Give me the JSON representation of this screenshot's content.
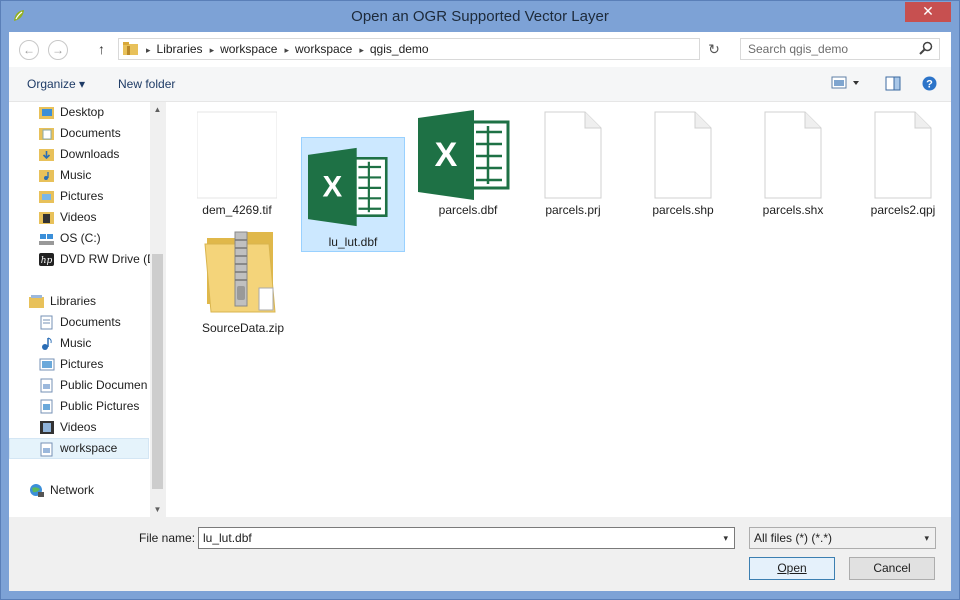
{
  "window": {
    "title": "Open an OGR Supported Vector Layer",
    "close_glyph": "✕"
  },
  "navbar": {
    "back_glyph": "←",
    "forward_glyph": "→",
    "up_glyph": "↑",
    "breadcrumbs": [
      "Libraries",
      "workspace",
      "workspace",
      "qgis_demo"
    ],
    "separator": "▸",
    "dropdown_glyph": "▾",
    "refresh_glyph": "↻",
    "search_placeholder": "Search qgis_demo"
  },
  "toolbar": {
    "organize_label": "Organize ▾",
    "new_folder_label": "New folder"
  },
  "sidebar": {
    "items": [
      {
        "label": "Desktop",
        "icon": "desktop-folder-icon"
      },
      {
        "label": "Documents",
        "icon": "documents-folder-icon"
      },
      {
        "label": "Downloads",
        "icon": "downloads-folder-icon"
      },
      {
        "label": "Music",
        "icon": "music-folder-icon"
      },
      {
        "label": "Pictures",
        "icon": "pictures-folder-icon"
      },
      {
        "label": "Videos",
        "icon": "videos-folder-icon"
      },
      {
        "label": "OS (C:)",
        "icon": "drive-icon"
      },
      {
        "label": "DVD RW Drive (D",
        "icon": "dvd-drive-icon"
      },
      {
        "label": "Libraries",
        "icon": "libraries-icon"
      },
      {
        "label": "Documents",
        "icon": "library-documents-icon"
      },
      {
        "label": "Music",
        "icon": "library-music-icon"
      },
      {
        "label": "Pictures",
        "icon": "library-pictures-icon"
      },
      {
        "label": "Public Documen",
        "icon": "library-public-documents-icon"
      },
      {
        "label": "Public Pictures",
        "icon": "library-public-pictures-icon"
      },
      {
        "label": "Videos",
        "icon": "library-videos-icon"
      },
      {
        "label": "workspace",
        "icon": "library-workspace-icon"
      },
      {
        "label": "Network",
        "icon": "network-icon"
      }
    ],
    "selected": "workspace"
  },
  "scrollbar": {
    "up_glyph": "▲",
    "down_glyph": "▼"
  },
  "files": [
    {
      "name": "dem_4269.tif",
      "type": "image"
    },
    {
      "name": "lu_lut.dbf",
      "type": "excel",
      "selected": true
    },
    {
      "name": "parcels.dbf",
      "type": "excel"
    },
    {
      "name": "parcels.prj",
      "type": "generic"
    },
    {
      "name": "parcels.shp",
      "type": "generic"
    },
    {
      "name": "parcels.shx",
      "type": "generic"
    },
    {
      "name": "parcels2.qpj",
      "type": "generic"
    },
    {
      "name": "SourceData.zip",
      "type": "zip"
    }
  ],
  "footer": {
    "file_name_label": "File name:",
    "file_name_value": "lu_lut.dbf",
    "filter_value": "All files (*) (*.*)",
    "open_label": "Open",
    "cancel_label": "Cancel",
    "arrow_glyph": "▾"
  },
  "colors": {
    "title_bar": "#7da2d6",
    "close_button": "#c75050",
    "selection": "#cce8ff",
    "excel_green": "#1e7145"
  }
}
